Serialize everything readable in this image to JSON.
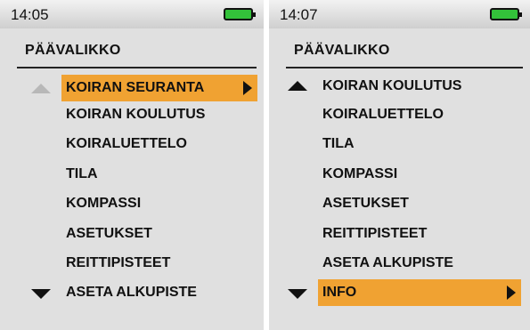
{
  "screens": [
    {
      "time": "14:05",
      "title": "PÄÄVALIKKO",
      "items": [
        "KOIRAN SEURANTA",
        "KOIRAN KOULUTUS",
        "KOIRALUETTELO",
        "TILA",
        "KOMPASSI",
        "ASETUKSET",
        "REITTIPISTEET",
        "ASETA ALKUPISTE"
      ],
      "selected": "KOIRAN SEURANTA",
      "scroll_up": "dim",
      "scroll_down": "active"
    },
    {
      "time": "14:07",
      "title": "PÄÄVALIKKO",
      "items": [
        "KOIRAN KOULUTUS",
        "KOIRALUETTELO",
        "TILA",
        "KOMPASSI",
        "ASETUKSET",
        "REITTIPISTEET",
        "ASETA ALKUPISTE",
        "INFO"
      ],
      "selected": "INFO",
      "scroll_up": "active",
      "scroll_down": "active"
    }
  ],
  "colors": {
    "highlight": "#f0a232",
    "battery": "#33c23a",
    "background": "#e0e0e0"
  },
  "icons": [
    "battery-icon",
    "scroll-up-icon",
    "scroll-down-icon",
    "chevron-right-icon"
  ]
}
